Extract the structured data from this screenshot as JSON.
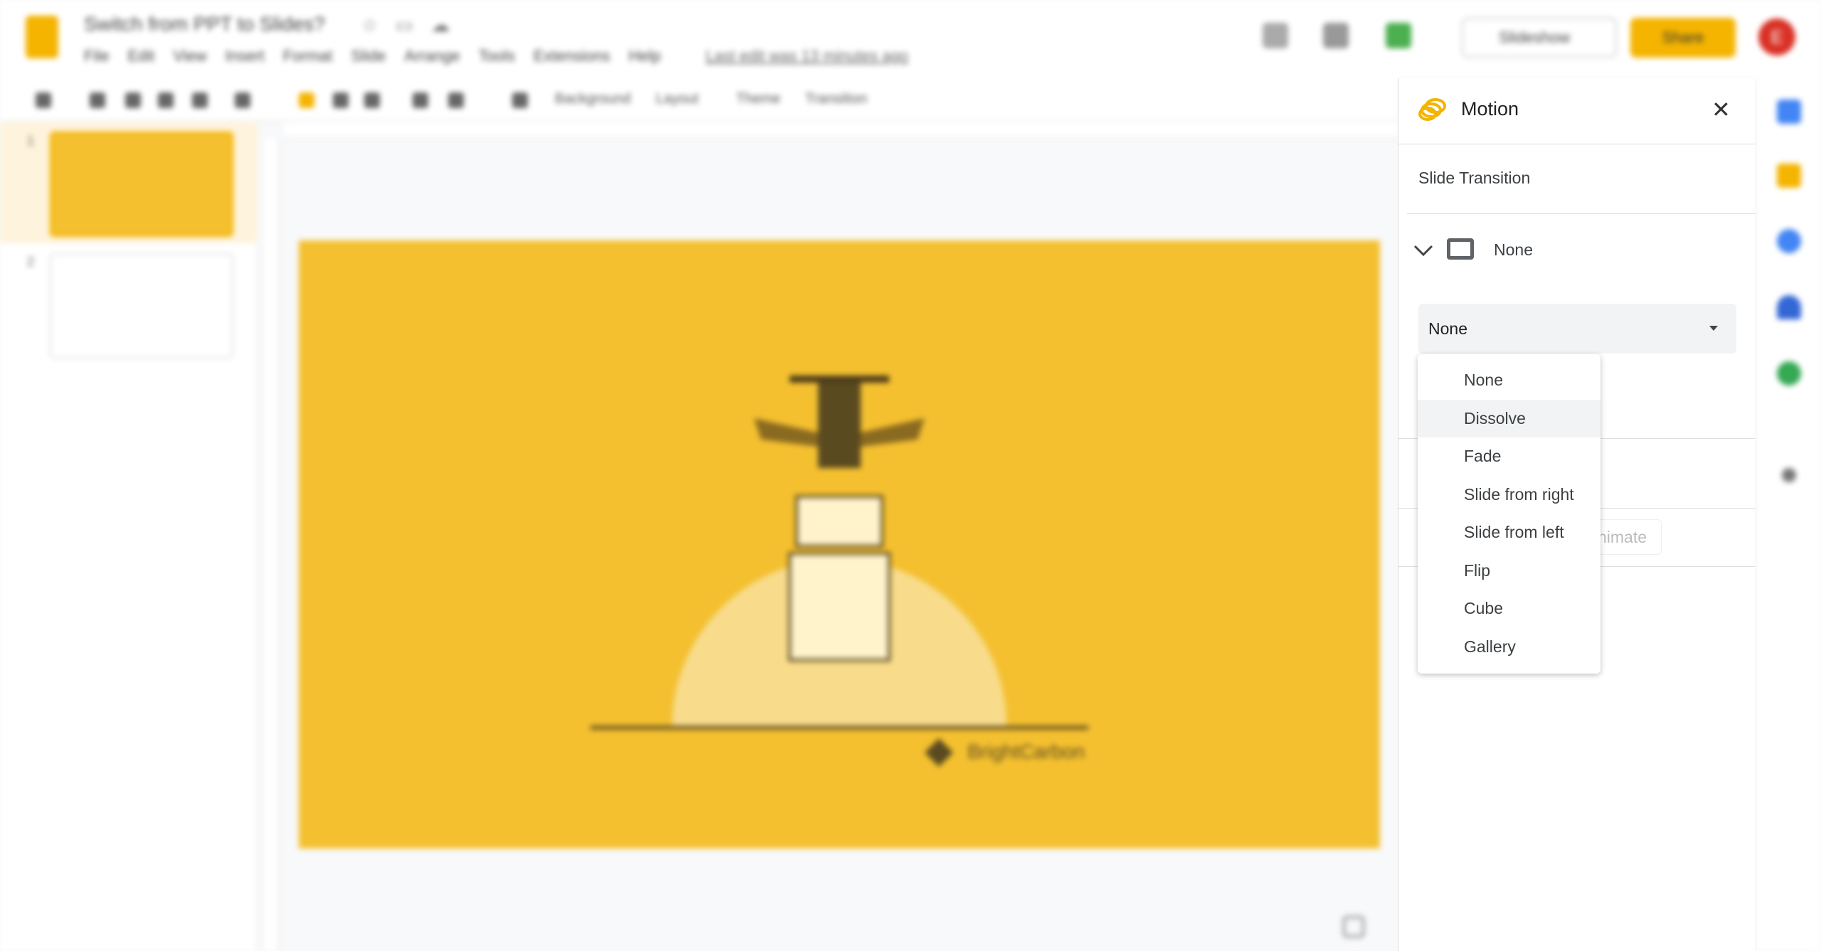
{
  "app": {
    "title": "Switch from PPT to Slides?",
    "last_edit": "Last edit was 13 minutes ago"
  },
  "menu": [
    "File",
    "Edit",
    "View",
    "Insert",
    "Format",
    "Slide",
    "Arrange",
    "Tools",
    "Extensions",
    "Help"
  ],
  "header": {
    "slideshow_label": "Slideshow",
    "share_label": "Share",
    "avatar_initial": "E"
  },
  "toolbar": {
    "background_label": "Background",
    "layout_label": "Layout",
    "theme_label": "Theme",
    "transition_label": "Transition"
  },
  "filmstrip": {
    "slides": [
      "1",
      "2"
    ]
  },
  "slide": {
    "logo_text": "BrightCarbon",
    "background_color": "#f4c030"
  },
  "motion_panel": {
    "title": "Motion",
    "section_title": "Slide Transition",
    "current_transition": "None",
    "select_value": "None",
    "animate_label": "animate",
    "options": [
      "None",
      "Dissolve",
      "Fade",
      "Slide from right",
      "Slide from left",
      "Flip",
      "Cube",
      "Gallery"
    ],
    "highlighted_option": "Dissolve"
  },
  "colors": {
    "accent": "#f4b400",
    "avatar": "#d93025"
  }
}
